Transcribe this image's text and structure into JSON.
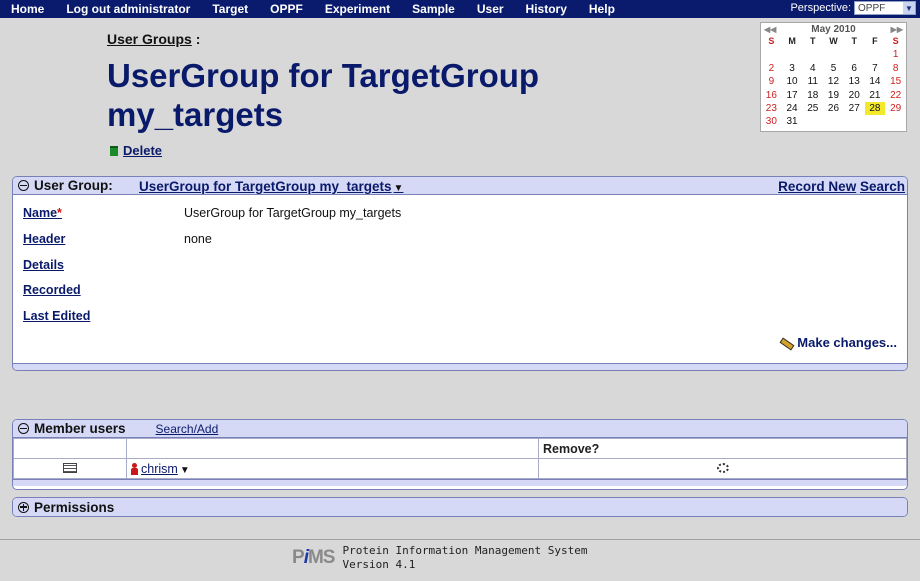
{
  "nav": {
    "items": [
      "Home",
      "Log out administrator",
      "Target",
      "OPPF",
      "Experiment",
      "Sample",
      "User",
      "History",
      "Help"
    ],
    "perspective_label": "Perspective:",
    "perspective_value": "OPPF"
  },
  "header": {
    "breadcrumb": "User Groups",
    "breadcrumb_suffix": " :",
    "title": "UserGroup for TargetGroup my_targets",
    "delete_label": "Delete"
  },
  "calendar": {
    "month_label": "May 2010",
    "days_of_week": [
      "S",
      "M",
      "T",
      "W",
      "T",
      "F",
      "S"
    ],
    "weeks": [
      [
        "",
        "",
        "",
        "",
        "",
        "",
        "1"
      ],
      [
        "2",
        "3",
        "4",
        "5",
        "6",
        "7",
        "8"
      ],
      [
        "9",
        "10",
        "11",
        "12",
        "13",
        "14",
        "15"
      ],
      [
        "16",
        "17",
        "18",
        "19",
        "20",
        "21",
        "22"
      ],
      [
        "23",
        "24",
        "25",
        "26",
        "27",
        "28",
        "29"
      ],
      [
        "30",
        "31",
        "",
        "",
        "",
        "",
        ""
      ]
    ],
    "today": "28"
  },
  "user_group_panel": {
    "label": "User Group:",
    "name": "UserGroup for TargetGroup my_targets",
    "record_new": "Record New",
    "search": "Search",
    "fields": [
      {
        "label": "Name",
        "required": "*",
        "value": "UserGroup for TargetGroup my_targets"
      },
      {
        "label": "Header",
        "required": "",
        "value": "none"
      },
      {
        "label": "Details",
        "required": "",
        "value": ""
      },
      {
        "label": "Recorded",
        "required": "",
        "value": ""
      },
      {
        "label": "Last Edited",
        "required": "",
        "value": ""
      }
    ],
    "make_changes": "Make changes..."
  },
  "member_users_panel": {
    "label": "Member users",
    "search_add": "Search/Add",
    "remove_header": "Remove?",
    "rows": [
      {
        "user": "chrism"
      }
    ]
  },
  "permissions_panel": {
    "label": "Permissions"
  },
  "footer": {
    "logo_p": "P",
    "logo_i": "i",
    "logo_ms": "MS",
    "line1": "Protein Information Management System",
    "line2": "Version 4.1"
  }
}
